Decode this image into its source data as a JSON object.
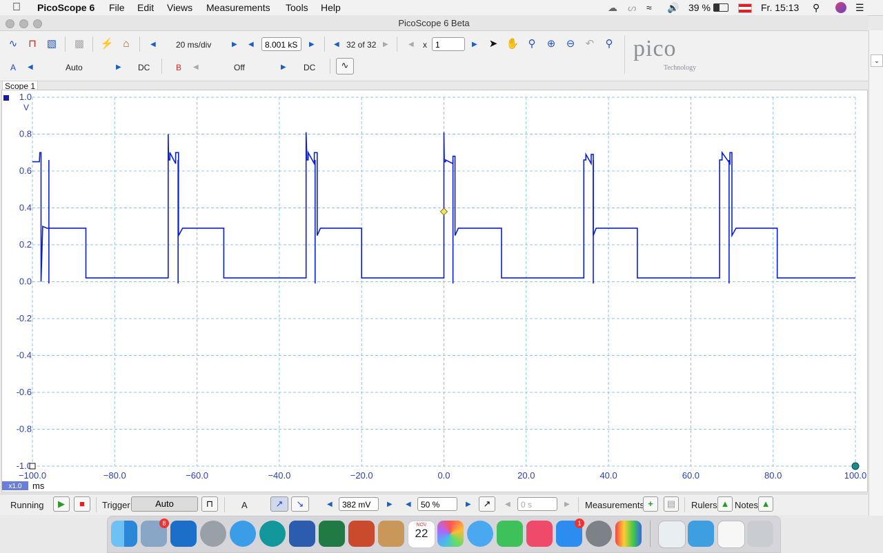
{
  "menubar": {
    "app": "PicoScope 6",
    "items": [
      "File",
      "Edit",
      "Views",
      "Measurements",
      "Tools",
      "Help"
    ],
    "battery": "39 %",
    "clock": "Fr. 15:13"
  },
  "window": {
    "title": "PicoScope 6 Beta"
  },
  "toolbar": {
    "timebase": "20 ms/div",
    "samples": "8.001 kS",
    "buffer": "32 of 32",
    "zoom_prefix": "x",
    "zoom_value": "1",
    "channel_a": {
      "label": "A",
      "range": "Auto",
      "coupling": "DC",
      "color": "#1a3fd6"
    },
    "channel_b": {
      "label": "B",
      "range": "Off",
      "coupling": "DC",
      "color": "#d62a2a"
    },
    "logo": "pico",
    "logo_sub": "Technology"
  },
  "scope": {
    "tab_label": "Scope 1",
    "y_unit": "V",
    "x_unit": "ms",
    "zoom_badge": "x1.0",
    "trace_color": "#0a1fd4",
    "grid_color": "#8fc6d8"
  },
  "chart_data": {
    "type": "line",
    "title": "",
    "xlabel": "ms",
    "ylabel": "V",
    "xlim": [
      -100,
      100
    ],
    "ylim": [
      -1,
      1
    ],
    "x_ticks": [
      "−100.0",
      "−80.0",
      "−60.0",
      "−40.0",
      "−20.0",
      "0.0",
      "20.0",
      "40.0",
      "60.0",
      "80.0",
      "100.0"
    ],
    "y_ticks": [
      "1.0",
      "0.8",
      "0.6",
      "0.4",
      "0.2",
      "0.0",
      "-0.2",
      "-0.4",
      "-0.6",
      "-0.8",
      "-1.0"
    ],
    "grid": true,
    "series": [
      {
        "x": [
          -100,
          -98.3,
          -98.2,
          -97.9,
          -97.9,
          -97.5,
          -96.5,
          -93,
          -87,
          -87,
          -86.5,
          -85,
          -67,
          -67,
          -66.9,
          -66.6,
          -66.6,
          -65.2,
          -65.2,
          -64.5,
          -64.5,
          -63.5,
          -63,
          -53.5,
          -53.5,
          -52,
          -33.5,
          -33.5,
          -33.3,
          -33,
          -33,
          -31.5,
          -31.5,
          -30.8,
          -30.8,
          -30,
          -29.5,
          -20,
          -20,
          -18.5,
          0,
          0,
          0.1,
          0.4,
          0.4,
          2.2,
          2.2,
          2.7,
          2.7,
          3.5,
          4,
          14,
          14,
          15.5,
          34,
          34,
          34.1,
          34.5,
          34.5,
          35.8,
          35.8,
          36.3,
          36.3,
          37,
          37.5,
          47,
          47,
          48.5,
          67,
          67,
          67.2,
          67.6,
          67.6,
          69.5,
          69.5,
          70,
          70,
          71,
          71.5,
          81,
          81,
          82.5,
          100
        ],
        "y": [
          0.65,
          0.65,
          0.7,
          0.7,
          0,
          0.3,
          0.29,
          0.29,
          0.29,
          0.02,
          0.02,
          0.02,
          0.02,
          0.8,
          0.66,
          0.66,
          0.7,
          0.64,
          0.7,
          0.7,
          0.25,
          0.29,
          0.29,
          0.29,
          0.02,
          0.02,
          0.02,
          0.81,
          0.66,
          0.66,
          0.7,
          0.64,
          0.7,
          0.7,
          0.25,
          0.29,
          0.29,
          0.29,
          0.02,
          0.02,
          0.02,
          0.81,
          0.65,
          0.65,
          0.66,
          0.64,
          0.68,
          0.68,
          0.25,
          0.29,
          0.29,
          0.29,
          0.02,
          0.02,
          0.02,
          0.66,
          0.66,
          0.66,
          0.69,
          0.64,
          0.69,
          0.69,
          0.25,
          0.29,
          0.29,
          0.29,
          0.02,
          0.02,
          0.02,
          0.66,
          0.66,
          0.66,
          0.7,
          0.64,
          0.7,
          0.7,
          0.25,
          0.29,
          0.29,
          0.29,
          0.02,
          0.02,
          0.02
        ]
      }
    ],
    "trigger_marker": {
      "x": 0,
      "y": 0.38
    }
  },
  "statusbar": {
    "state": "Running",
    "trigger_label": "Trigger",
    "trigger_mode": "Auto",
    "trigger_channel": "A",
    "threshold": "382 mV",
    "pretrigger": "50 %",
    "delay": "0 s",
    "measurements": "Measurements",
    "rulers": "Rulers",
    "notes": "Notes"
  },
  "dock": {
    "mail_badge": "8",
    "appstore_badge": "1",
    "calendar_month": "NOV",
    "calendar_day": "22"
  }
}
